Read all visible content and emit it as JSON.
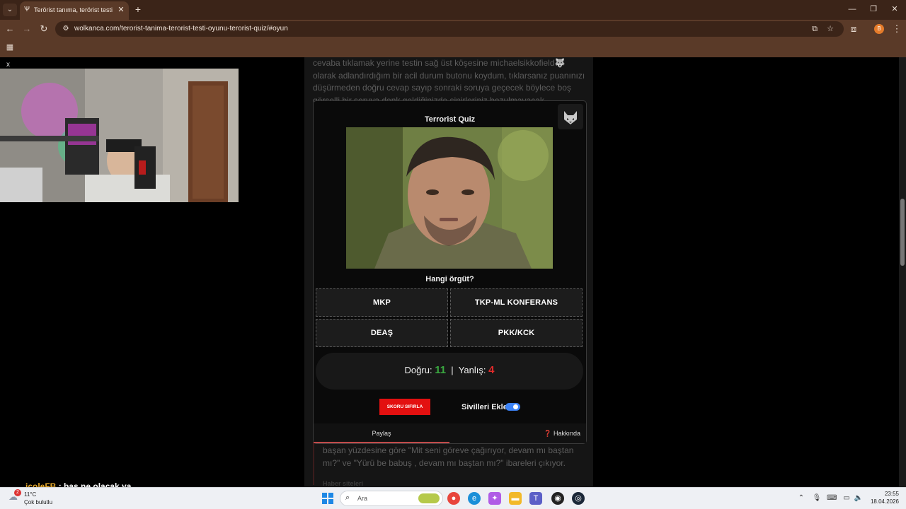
{
  "browser": {
    "tab_title": "Terörist tanıma, terörist testi oyu",
    "tab_favicon": "wolf-favicon-icon",
    "url": "wolkanca.com/terorist-tanima-terorist-testi-oyunu-terorist-quiz/#oyun",
    "profile_initial": "B"
  },
  "article": {
    "top_text": "cevaba tıklamak yerine testin sağ üst köşesine michaelsikkofield🐺 olarak adlandırdığım bir acil durum butonu koydum, tıklarsanız puanınızı düşürmeden doğru cevap sayıp sonraki soruya geçecek böylece boş görselli bir soruya denk geldiğinizde sinirleriniz bozulmayacak.",
    "bottom_text": "başan yüzdesine göre \"Mit seni göreve çağırıyor, devam mı baştan mı?\" ve \"Yürü be babuş , devam mı baştan mı?\" ibareleri çıkıyor.",
    "sub_heading": "Haber siteleri"
  },
  "webcam": {
    "close_label": "x"
  },
  "quiz": {
    "title": "Terrorist Quiz",
    "question": "Hangi örgüt?",
    "options": [
      "MKP",
      "TKP-ML KONFERANS",
      "DEAŞ",
      "PKK/KCK"
    ],
    "score_correct_label": "Doğru:",
    "score_correct": "11",
    "score_separator": "|",
    "score_wrong_label": "Yanlış:",
    "score_wrong": "4",
    "reset_label": "SKORU SIFIRLA",
    "toggle_label": "Sivilleri Ekle",
    "toggle_on": true,
    "share_label": "Paylaş",
    "about_label": "Hakkında",
    "about_icon": "❓"
  },
  "chat": {
    "user": "jcoleFB",
    "message": ": bas ne olacak ya"
  },
  "taskbar": {
    "weather_temp": "11°C",
    "weather_desc": "Çok bulutlu",
    "weather_badge": "2",
    "search_placeholder": "Ara",
    "time": "23:55",
    "date": "18.04.2026"
  },
  "colors": {
    "chrome": "#5a3a28",
    "correct": "#39a83f",
    "wrong": "#e02a2a",
    "reset": "#e31010",
    "toggle": "#3b82f6"
  }
}
